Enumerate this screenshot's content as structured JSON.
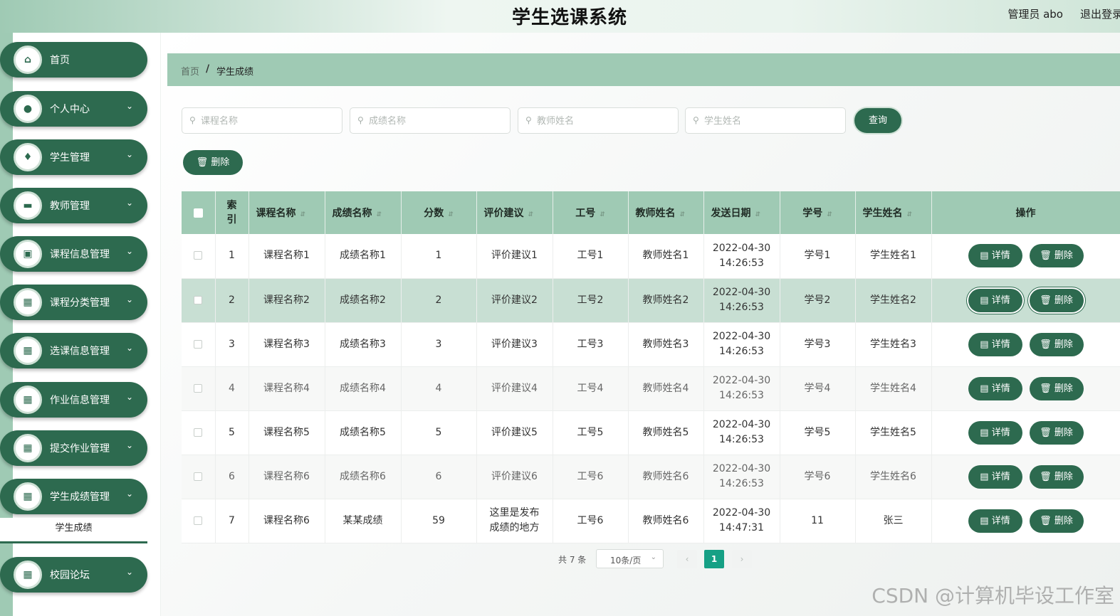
{
  "header": {
    "title": "学生选课系统",
    "user": "管理员 abo",
    "logout": "退出登录"
  },
  "sidebar": {
    "items": [
      {
        "label": "首页",
        "icon": "home-icon",
        "glyph": "⌂",
        "has_arrow": false
      },
      {
        "label": "个人中心",
        "icon": "user-icon",
        "glyph": "●",
        "has_arrow": true
      },
      {
        "label": "学生管理",
        "icon": "bulb-icon",
        "glyph": "♦",
        "has_arrow": true
      },
      {
        "label": "教师管理",
        "icon": "teacher-icon",
        "glyph": "▬",
        "has_arrow": true
      },
      {
        "label": "课程信息管理",
        "icon": "briefcase-icon",
        "glyph": "▣",
        "has_arrow": true
      },
      {
        "label": "课程分类管理",
        "icon": "grid-icon",
        "glyph": "▦",
        "has_arrow": true
      },
      {
        "label": "选课信息管理",
        "icon": "grid-icon",
        "glyph": "▦",
        "has_arrow": true
      },
      {
        "label": "作业信息管理",
        "icon": "grid-icon",
        "glyph": "▦",
        "has_arrow": true
      },
      {
        "label": "提交作业管理",
        "icon": "grid-icon",
        "glyph": "▦",
        "has_arrow": true
      },
      {
        "label": "学生成绩管理",
        "icon": "grid-icon",
        "glyph": "▦",
        "has_arrow": true
      },
      {
        "label": "校园论坛",
        "icon": "grid-icon",
        "glyph": "▦",
        "has_arrow": true
      }
    ],
    "submenu_label": "学生成绩"
  },
  "breadcrumb": {
    "home": "首页",
    "separator": "/",
    "current": "学生成绩"
  },
  "search": {
    "course_name_placeholder": "课程名称",
    "score_name_placeholder": "成绩名称",
    "teacher_name_placeholder": "教师姓名",
    "student_name_placeholder": "学生姓名",
    "query_label": "查询"
  },
  "toolbar": {
    "delete_label": "删除"
  },
  "table": {
    "headers": [
      "索引",
      "课程名称",
      "成绩名称",
      "分数",
      "评价建议",
      "工号",
      "教师姓名",
      "发送日期",
      "学号",
      "学生姓名",
      "操作"
    ],
    "rows": [
      {
        "index": "1",
        "course": "课程名称1",
        "score_name": "成绩名称1",
        "score": "1",
        "advice": "评价建议1",
        "job_no": "工号1",
        "teacher": "教师姓名1",
        "date": "2022-04-30",
        "time": "14:26:53",
        "student_no": "学号1",
        "student": "学生姓名1"
      },
      {
        "index": "2",
        "course": "课程名称2",
        "score_name": "成绩名称2",
        "score": "2",
        "advice": "评价建议2",
        "job_no": "工号2",
        "teacher": "教师姓名2",
        "date": "2022-04-30",
        "time": "14:26:53",
        "student_no": "学号2",
        "student": "学生姓名2"
      },
      {
        "index": "3",
        "course": "课程名称3",
        "score_name": "成绩名称3",
        "score": "3",
        "advice": "评价建议3",
        "job_no": "工号3",
        "teacher": "教师姓名3",
        "date": "2022-04-30",
        "time": "14:26:53",
        "student_no": "学号3",
        "student": "学生姓名3"
      },
      {
        "index": "4",
        "course": "课程名称4",
        "score_name": "成绩名称4",
        "score": "4",
        "advice": "评价建议4",
        "job_no": "工号4",
        "teacher": "教师姓名4",
        "date": "2022-04-30",
        "time": "14:26:53",
        "student_no": "学号4",
        "student": "学生姓名4"
      },
      {
        "index": "5",
        "course": "课程名称5",
        "score_name": "成绩名称5",
        "score": "5",
        "advice": "评价建议5",
        "job_no": "工号5",
        "teacher": "教师姓名5",
        "date": "2022-04-30",
        "time": "14:26:53",
        "student_no": "学号5",
        "student": "学生姓名5"
      },
      {
        "index": "6",
        "course": "课程名称6",
        "score_name": "成绩名称6",
        "score": "6",
        "advice": "评价建议6",
        "job_no": "工号6",
        "teacher": "教师姓名6",
        "date": "2022-04-30",
        "time": "14:26:53",
        "student_no": "学号6",
        "student": "学生姓名6"
      },
      {
        "index": "7",
        "course": "课程名称6",
        "score_name": "某某成绩",
        "score": "59",
        "advice": "这里是发布成绩的地方",
        "job_no": "工号6",
        "teacher": "教师姓名6",
        "date": "2022-04-30",
        "time": "14:47:31",
        "student_no": "11",
        "student": "张三"
      }
    ],
    "detail_label": "详情",
    "delete_label": "删除"
  },
  "pagination": {
    "total": "共 7 条",
    "page_size": "10条/页",
    "current_page": "1"
  },
  "watermark": "CSDN @计算机毕设工作室",
  "colors": {
    "primary": "#2d6a4f",
    "accent_light": "#9fcab4",
    "page_active": "#16a085"
  }
}
